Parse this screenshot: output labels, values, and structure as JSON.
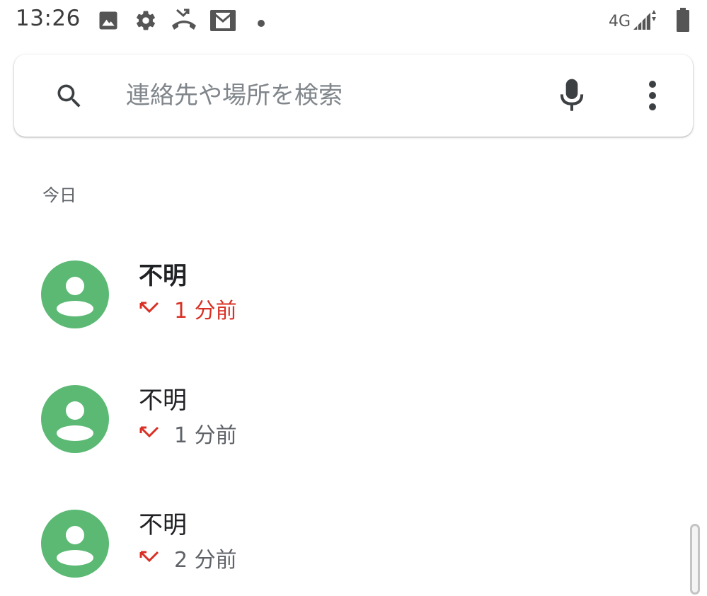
{
  "status_bar": {
    "time": "13:26",
    "network": "4G",
    "icons": [
      "image-icon",
      "gear-icon",
      "missed-call-icon",
      "gmail-icon",
      "dot-icon",
      "signal-icon",
      "battery-icon"
    ]
  },
  "search": {
    "placeholder": "連絡先や場所を検索",
    "icon": "search-icon",
    "mic_icon": "mic-icon",
    "more_icon": "more-vert-icon"
  },
  "section": {
    "today_label": "今日"
  },
  "calls": [
    {
      "name": "不明",
      "time": "1 分前",
      "new_missed": true
    },
    {
      "name": "不明",
      "time": "1 分前",
      "new_missed": false
    },
    {
      "name": "不明",
      "time": "2 分前",
      "new_missed": false
    }
  ],
  "colors": {
    "avatar": "#5bb974",
    "missed": "#d93025",
    "secondary_text": "#5f6368",
    "primary_text": "#202124"
  }
}
